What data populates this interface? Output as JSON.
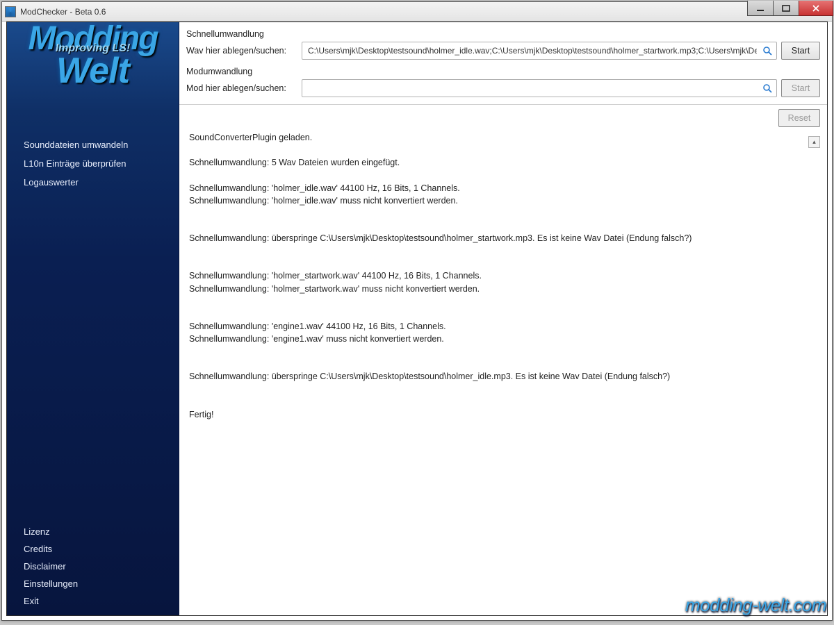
{
  "window": {
    "title": "ModChecker - Beta 0.6"
  },
  "logo": {
    "line1": "Modding",
    "line2": "Welt",
    "tagline": "Improving LS!"
  },
  "sidebar": {
    "top": [
      {
        "label": "Sounddateien umwandeln"
      },
      {
        "label": "L10n Einträge überprüfen"
      },
      {
        "label": "Logauswerter"
      }
    ],
    "bottom": [
      {
        "label": "Lizenz"
      },
      {
        "label": "Credits"
      },
      {
        "label": "Disclaimer"
      },
      {
        "label": "Einstellungen"
      },
      {
        "label": "Exit"
      }
    ]
  },
  "form": {
    "quick": {
      "group_label": "Schnellumwandlung",
      "field_label": "Wav hier ablegen/suchen:",
      "value": "C:\\Users\\mjk\\Desktop\\testsound\\holmer_idle.wav;C:\\Users\\mjk\\Desktop\\testsound\\holmer_startwork.mp3;C:\\Users\\mjk\\Deskt",
      "start_label": "Start"
    },
    "mod": {
      "group_label": "Modumwandlung",
      "field_label": "Mod hier ablegen/suchen:",
      "value": "",
      "start_label": "Start"
    },
    "reset_label": "Reset"
  },
  "log": [
    "SoundConverterPlugin geladen.",
    "",
    "Schnellumwandlung: 5 Wav Dateien wurden eingefügt.",
    "",
    "Schnellumwandlung: 'holmer_idle.wav' 44100 Hz, 16 Bits, 1 Channels.",
    "Schnellumwandlung: 'holmer_idle.wav' muss nicht konvertiert werden.",
    "",
    "",
    "Schnellumwandlung: überspringe C:\\Users\\mjk\\Desktop\\testsound\\holmer_startwork.mp3. Es ist keine Wav Datei (Endung falsch?)",
    "",
    "",
    "Schnellumwandlung: 'holmer_startwork.wav' 44100 Hz, 16 Bits, 1 Channels.",
    "Schnellumwandlung: 'holmer_startwork.wav' muss nicht konvertiert werden.",
    "",
    "",
    "Schnellumwandlung: 'engine1.wav' 44100 Hz, 16 Bits, 1 Channels.",
    "Schnellumwandlung: 'engine1.wav' muss nicht konvertiert werden.",
    "",
    "",
    "Schnellumwandlung: überspringe C:\\Users\\mjk\\Desktop\\testsound\\holmer_idle.mp3. Es ist keine Wav Datei (Endung falsch?)",
    "",
    "",
    "Fertig!"
  ],
  "watermark": "modding-welt.com"
}
